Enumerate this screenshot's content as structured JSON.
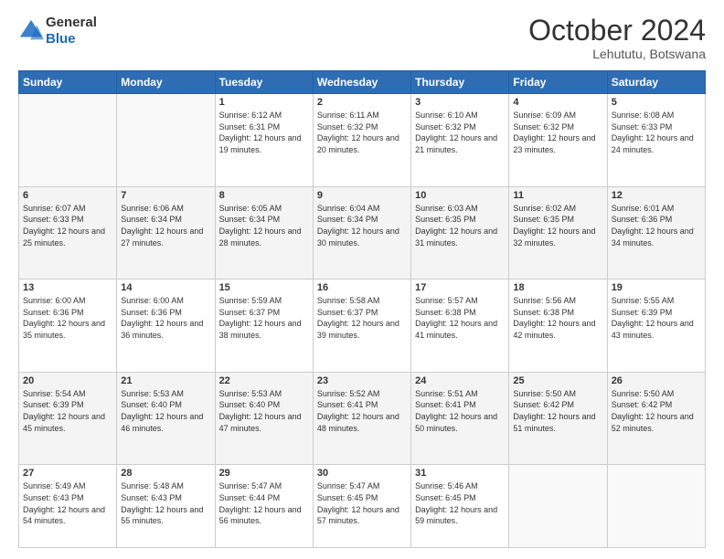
{
  "header": {
    "logo": {
      "general": "General",
      "blue": "Blue"
    },
    "title": "October 2024",
    "location": "Lehututu, Botswana"
  },
  "days_of_week": [
    "Sunday",
    "Monday",
    "Tuesday",
    "Wednesday",
    "Thursday",
    "Friday",
    "Saturday"
  ],
  "weeks": [
    [
      {
        "day": null
      },
      {
        "day": null
      },
      {
        "day": 1,
        "sunrise": "6:12 AM",
        "sunset": "6:31 PM",
        "daylight": "12 hours and 19 minutes."
      },
      {
        "day": 2,
        "sunrise": "6:11 AM",
        "sunset": "6:32 PM",
        "daylight": "12 hours and 20 minutes."
      },
      {
        "day": 3,
        "sunrise": "6:10 AM",
        "sunset": "6:32 PM",
        "daylight": "12 hours and 21 minutes."
      },
      {
        "day": 4,
        "sunrise": "6:09 AM",
        "sunset": "6:32 PM",
        "daylight": "12 hours and 23 minutes."
      },
      {
        "day": 5,
        "sunrise": "6:08 AM",
        "sunset": "6:33 PM",
        "daylight": "12 hours and 24 minutes."
      }
    ],
    [
      {
        "day": 6,
        "sunrise": "6:07 AM",
        "sunset": "6:33 PM",
        "daylight": "12 hours and 25 minutes."
      },
      {
        "day": 7,
        "sunrise": "6:06 AM",
        "sunset": "6:34 PM",
        "daylight": "12 hours and 27 minutes."
      },
      {
        "day": 8,
        "sunrise": "6:05 AM",
        "sunset": "6:34 PM",
        "daylight": "12 hours and 28 minutes."
      },
      {
        "day": 9,
        "sunrise": "6:04 AM",
        "sunset": "6:34 PM",
        "daylight": "12 hours and 30 minutes."
      },
      {
        "day": 10,
        "sunrise": "6:03 AM",
        "sunset": "6:35 PM",
        "daylight": "12 hours and 31 minutes."
      },
      {
        "day": 11,
        "sunrise": "6:02 AM",
        "sunset": "6:35 PM",
        "daylight": "12 hours and 32 minutes."
      },
      {
        "day": 12,
        "sunrise": "6:01 AM",
        "sunset": "6:36 PM",
        "daylight": "12 hours and 34 minutes."
      }
    ],
    [
      {
        "day": 13,
        "sunrise": "6:00 AM",
        "sunset": "6:36 PM",
        "daylight": "12 hours and 35 minutes."
      },
      {
        "day": 14,
        "sunrise": "6:00 AM",
        "sunset": "6:36 PM",
        "daylight": "12 hours and 36 minutes."
      },
      {
        "day": 15,
        "sunrise": "5:59 AM",
        "sunset": "6:37 PM",
        "daylight": "12 hours and 38 minutes."
      },
      {
        "day": 16,
        "sunrise": "5:58 AM",
        "sunset": "6:37 PM",
        "daylight": "12 hours and 39 minutes."
      },
      {
        "day": 17,
        "sunrise": "5:57 AM",
        "sunset": "6:38 PM",
        "daylight": "12 hours and 41 minutes."
      },
      {
        "day": 18,
        "sunrise": "5:56 AM",
        "sunset": "6:38 PM",
        "daylight": "12 hours and 42 minutes."
      },
      {
        "day": 19,
        "sunrise": "5:55 AM",
        "sunset": "6:39 PM",
        "daylight": "12 hours and 43 minutes."
      }
    ],
    [
      {
        "day": 20,
        "sunrise": "5:54 AM",
        "sunset": "6:39 PM",
        "daylight": "12 hours and 45 minutes."
      },
      {
        "day": 21,
        "sunrise": "5:53 AM",
        "sunset": "6:40 PM",
        "daylight": "12 hours and 46 minutes."
      },
      {
        "day": 22,
        "sunrise": "5:53 AM",
        "sunset": "6:40 PM",
        "daylight": "12 hours and 47 minutes."
      },
      {
        "day": 23,
        "sunrise": "5:52 AM",
        "sunset": "6:41 PM",
        "daylight": "12 hours and 48 minutes."
      },
      {
        "day": 24,
        "sunrise": "5:51 AM",
        "sunset": "6:41 PM",
        "daylight": "12 hours and 50 minutes."
      },
      {
        "day": 25,
        "sunrise": "5:50 AM",
        "sunset": "6:42 PM",
        "daylight": "12 hours and 51 minutes."
      },
      {
        "day": 26,
        "sunrise": "5:50 AM",
        "sunset": "6:42 PM",
        "daylight": "12 hours and 52 minutes."
      }
    ],
    [
      {
        "day": 27,
        "sunrise": "5:49 AM",
        "sunset": "6:43 PM",
        "daylight": "12 hours and 54 minutes."
      },
      {
        "day": 28,
        "sunrise": "5:48 AM",
        "sunset": "6:43 PM",
        "daylight": "12 hours and 55 minutes."
      },
      {
        "day": 29,
        "sunrise": "5:47 AM",
        "sunset": "6:44 PM",
        "daylight": "12 hours and 56 minutes."
      },
      {
        "day": 30,
        "sunrise": "5:47 AM",
        "sunset": "6:45 PM",
        "daylight": "12 hours and 57 minutes."
      },
      {
        "day": 31,
        "sunrise": "5:46 AM",
        "sunset": "6:45 PM",
        "daylight": "12 hours and 59 minutes."
      },
      {
        "day": null
      },
      {
        "day": null
      }
    ]
  ]
}
